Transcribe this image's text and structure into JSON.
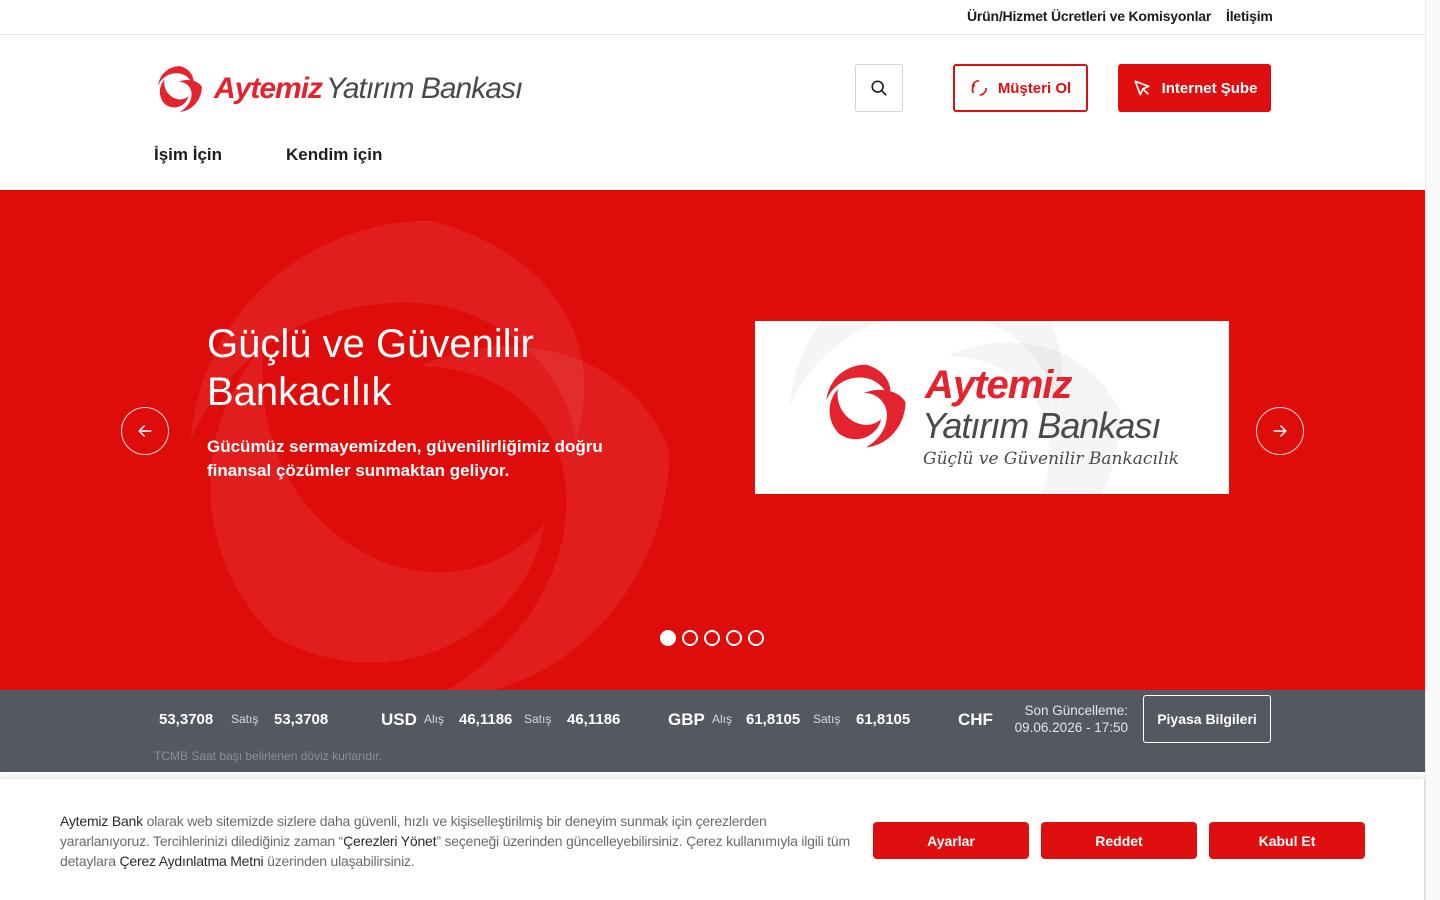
{
  "topbar": {
    "fees_link": "Ürün/Hizmet Ücretleri ve Komisyonlar",
    "contact_link": "İletişim"
  },
  "header": {
    "brand_primary": "Aytemiz",
    "brand_secondary": "Yatırım Bankası",
    "become_customer": "Müşteri Ol",
    "internet_branch": "Internet Şube",
    "nav": [
      "İşim İçin",
      "Kendim için"
    ]
  },
  "hero": {
    "title": "Güçlü ve Güvenilir Bankacılık",
    "subtitle": "Gücümüz sermayemizden, güvenilirliğimiz doğru finansal çözümler sunmaktan geliyor.",
    "promo_brand_primary": "Aytemiz",
    "promo_brand_secondary": "Yatırım Bankası",
    "promo_tagline": "Güçlü ve Güvenilir Bankacılık",
    "slide_count": 5,
    "active_slide": 1
  },
  "rates": {
    "items": [
      {
        "currency": "",
        "buy_label": "",
        "buy": "53,3708",
        "sell_label": "Satış",
        "sell": "53,3708"
      },
      {
        "currency": "USD",
        "buy_label": "Alış",
        "buy": "46,1186",
        "sell_label": "Satış",
        "sell": "46,1186"
      },
      {
        "currency": "GBP",
        "buy_label": "Alış",
        "buy": "61,8105",
        "sell_label": "Satış",
        "sell": "61,8105"
      },
      {
        "currency": "CHF"
      }
    ],
    "last_update_label": "Son Güncelleme:",
    "last_update_value": "09.06.2026 - 17:50",
    "market_button": "Piyasa Bilgileri",
    "note": "TCMB Saat başı belirlenen döviz kurlarıdır."
  },
  "cookie": {
    "text_part1": "Aytemiz Bank",
    "text_part2": " olarak web sitemizde sizlere daha güvenli, hızlı ve kişiselleştirilmiş bir deneyim sunmak için çerezlerden yararlanıyoruz. Tercihlerinizi dilediğiniz zaman “",
    "text_part3": "Çerezleri Yönet",
    "text_part4": "” seçeneği üzerinden güncelleyebilirsiniz. Çerez kullanımıyla ilgili tüm detaylara ",
    "text_part5": "Çerez Aydınlatma Metni",
    "text_part6": " üzerinden ulaşabilirsiniz.",
    "settings": "Ayarlar",
    "reject": "Reddet",
    "accept": "Kabul Et"
  },
  "colors": {
    "brand_red": "#e00f0f",
    "rates_bg": "#545861"
  }
}
